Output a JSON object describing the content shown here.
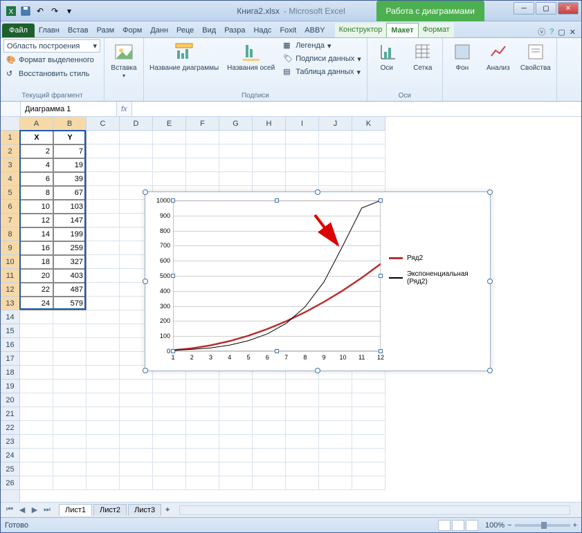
{
  "window": {
    "doc_title": "Книга2.xlsx",
    "app_title": "Microsoft Excel",
    "context_header": "Работа с диаграммами"
  },
  "qat": {
    "save": "save",
    "undo": "undo",
    "redo": "redo"
  },
  "tabs": {
    "file": "Файл",
    "list": [
      "Главн",
      "Встав",
      "Разм",
      "Форм",
      "Данн",
      "Реце",
      "Вид",
      "Разра",
      "Надс",
      "Foxit",
      "ABBY"
    ],
    "ctx": [
      "Конструктор",
      "Макет",
      "Формат"
    ],
    "active_ctx": 1
  },
  "ribbon": {
    "g1": {
      "label": "Текущий фрагмент",
      "selector": "Область построения",
      "format_sel": "Формат выделенного",
      "reset": "Восстановить стиль"
    },
    "g2": {
      "insert": "Вставка"
    },
    "g3": {
      "label": "Подписи",
      "chart_title": "Название\nдиаграммы",
      "axis_title": "Названия\nосей",
      "legend": "Легенда",
      "data_labels": "Подписи данных",
      "data_table": "Таблица данных"
    },
    "g4": {
      "label": "Оси",
      "axes": "Оси",
      "grid": "Сетка"
    },
    "g5": {
      "bg": "Фон",
      "analysis": "Анализ",
      "props": "Свойства"
    }
  },
  "formula": {
    "name": "Диаграмма 1",
    "fx": "fx",
    "value": ""
  },
  "columns": [
    "A",
    "B",
    "C",
    "D",
    "E",
    "F",
    "G",
    "H",
    "I",
    "J",
    "K"
  ],
  "row_count": 26,
  "table": {
    "headers": {
      "x": "X",
      "y": "Y"
    },
    "rows": [
      {
        "x": 2,
        "y": 7
      },
      {
        "x": 4,
        "y": 19
      },
      {
        "x": 6,
        "y": 39
      },
      {
        "x": 8,
        "y": 67
      },
      {
        "x": 10,
        "y": 103
      },
      {
        "x": 12,
        "y": 147
      },
      {
        "x": 14,
        "y": 199
      },
      {
        "x": 16,
        "y": 259
      },
      {
        "x": 18,
        "y": 327
      },
      {
        "x": 20,
        "y": 403
      },
      {
        "x": 22,
        "y": 487
      },
      {
        "x": 24,
        "y": 579
      }
    ]
  },
  "chart_data": {
    "type": "line",
    "x": [
      1,
      2,
      3,
      4,
      5,
      6,
      7,
      8,
      9,
      10,
      11,
      12
    ],
    "series": [
      {
        "name": "Ряд2",
        "color": "#b83030",
        "width": 2.5,
        "values": [
          7,
          19,
          39,
          67,
          103,
          147,
          199,
          259,
          327,
          403,
          487,
          579
        ]
      },
      {
        "name": "Экспоненциальная (Ряд2)",
        "color": "#000",
        "width": 1,
        "values": [
          6,
          12,
          22,
          40,
          70,
          115,
          185,
          295,
          460,
          700,
          950,
          1000
        ]
      }
    ],
    "ylim": [
      0,
      1000
    ],
    "yticks": [
      0,
      100,
      200,
      300,
      400,
      500,
      600,
      700,
      800,
      900,
      1000
    ],
    "xticks": [
      1,
      2,
      3,
      4,
      5,
      6,
      7,
      8,
      9,
      10,
      11,
      12
    ],
    "legend": [
      "Ряд2",
      "Экспоненциальная (Ряд2)"
    ]
  },
  "sheets": {
    "nav": [
      "⏮",
      "◀",
      "▶",
      "⏭"
    ],
    "tabs": [
      "Лист1",
      "Лист2",
      "Лист3"
    ],
    "active": 0
  },
  "status": {
    "ready": "Готово",
    "zoom": "100%"
  }
}
